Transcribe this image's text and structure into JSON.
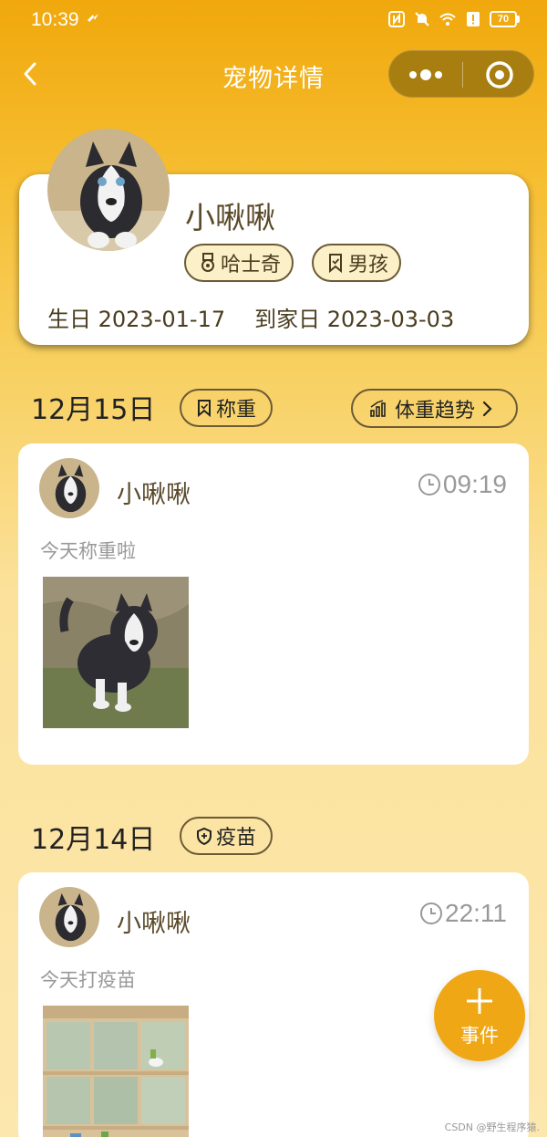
{
  "status_bar": {
    "time": "10:39",
    "battery": "70"
  },
  "nav": {
    "title": "宠物详情"
  },
  "profile": {
    "name": "小啾啾",
    "breed": "哈士奇",
    "gender": "男孩",
    "birthday_label": "生日 2023-01-17",
    "home_label": "到家日 2023-03-03"
  },
  "trend_button": {
    "label": "体重趋势"
  },
  "days": [
    {
      "date": "12月15日",
      "tag": "称重",
      "event": {
        "name": "小啾啾",
        "time": "09:19",
        "desc": "今天称重啦"
      }
    },
    {
      "date": "12月14日",
      "tag": "疫苗",
      "event": {
        "name": "小啾啾",
        "time": "22:11",
        "desc": "今天打疫苗"
      }
    }
  ],
  "fab": {
    "label": "事件"
  },
  "watermark": "CSDN @野生程序猿.",
  "colors": {
    "accent": "#F0A80C",
    "fab": "#EFA716",
    "capsule": "#A97E11",
    "tag_bg": "#FCF0C8"
  },
  "icons": {
    "medal": "medal-icon",
    "bookmark": "bookmark-icon",
    "shield": "shield-icon",
    "chart": "bar-chart-icon",
    "clock": "clock-icon",
    "back": "chevron-left-icon"
  }
}
